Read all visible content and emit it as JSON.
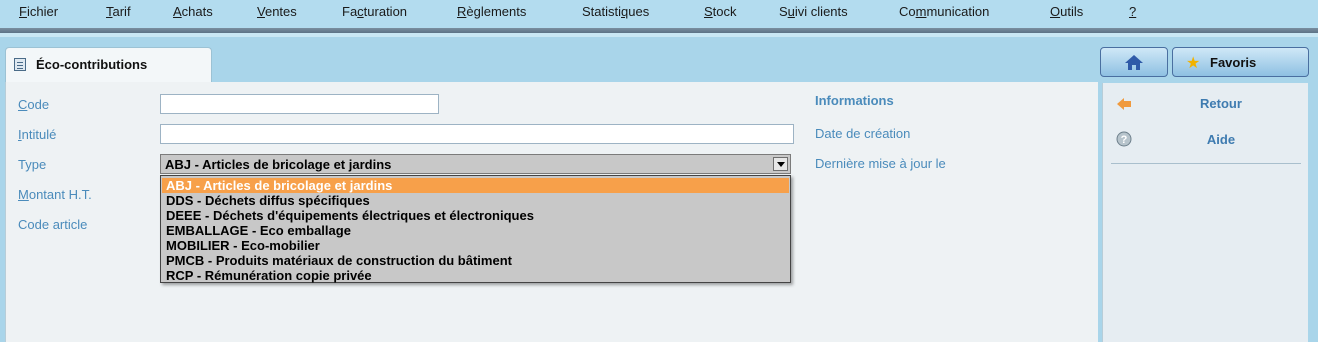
{
  "menu": [
    {
      "pre": "",
      "u": "F",
      "post": "ichier"
    },
    {
      "pre": "",
      "u": "T",
      "post": "arif"
    },
    {
      "pre": "",
      "u": "A",
      "post": "chats"
    },
    {
      "pre": "",
      "u": "V",
      "post": "entes"
    },
    {
      "pre": "Fa",
      "u": "c",
      "post": "turation"
    },
    {
      "pre": "",
      "u": "R",
      "post": "èglements"
    },
    {
      "pre": "Statisti",
      "u": "q",
      "post": "ues"
    },
    {
      "pre": "",
      "u": "S",
      "post": "tock"
    },
    {
      "pre": "S",
      "u": "u",
      "post": "ivi clients"
    },
    {
      "pre": "Co",
      "u": "m",
      "post": "munication"
    },
    {
      "pre": "",
      "u": "O",
      "post": "utils"
    },
    {
      "pre": "",
      "u": "?",
      "post": ""
    }
  ],
  "tab": {
    "label": "Éco-contributions"
  },
  "form": {
    "code": {
      "label_u": "C",
      "label_rest": "ode",
      "value": ""
    },
    "intitule": {
      "label_u": "I",
      "label_rest": "ntitulé",
      "value": ""
    },
    "type": {
      "label": "Type",
      "value": "ABJ - Articles de bricolage et jardins"
    },
    "montant": {
      "label_u": "M",
      "label_rest": "ontant H.T."
    },
    "code_article": {
      "label": "Code article"
    }
  },
  "type_options": [
    "ABJ - Articles de bricolage et jardins",
    "DDS - Déchets diffus spécifiques",
    "DEEE - Déchets d'équipements électriques et électroniques",
    "EMBALLAGE - Eco emballage",
    "MOBILIER - Eco-mobilier",
    "PMCB - Produits matériaux de construction du bâtiment",
    "RCP - Rémunération copie privée"
  ],
  "selected_option_index": 0,
  "info": {
    "title": "Informations",
    "date_creation": "Date de création",
    "derniere_maj": "Dernière mise à jour le"
  },
  "toolbar": {
    "favoris_label": "Favoris"
  },
  "side": {
    "retour_label": "Retour",
    "aide_label": "Aide"
  },
  "colors": {
    "accent": "#4a8bbb",
    "selection": "#f7a04a",
    "background": "#a9d5ea"
  }
}
